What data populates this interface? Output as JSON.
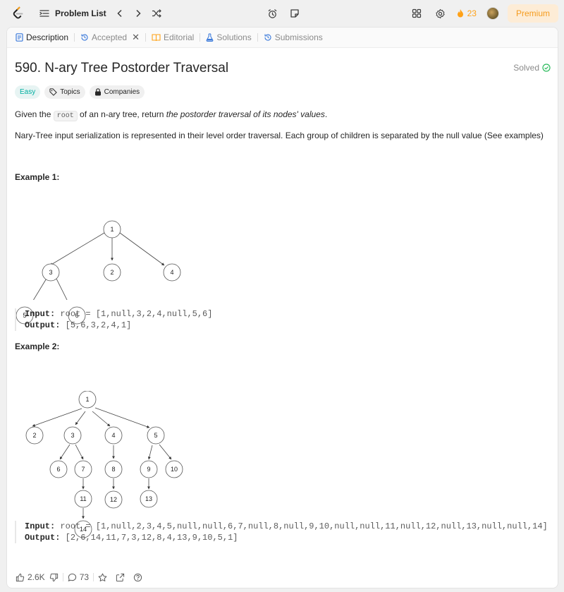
{
  "nav": {
    "problem_list": "Problem List",
    "streak": "23",
    "premium": "Premium",
    "colors": {
      "accent": "#ffa116",
      "easy": "#00afa1",
      "solved": "#2cbb5d"
    }
  },
  "tabs": [
    {
      "label": "Description",
      "icon": "description-icon"
    },
    {
      "label": "Accepted",
      "icon": "history-icon"
    },
    {
      "label": "Editorial",
      "icon": "book-icon"
    },
    {
      "label": "Solutions",
      "icon": "flask-icon"
    },
    {
      "label": "Submissions",
      "icon": "history-icon"
    }
  ],
  "problem": {
    "title": "590. N-ary Tree Postorder Traversal",
    "status": "Solved",
    "difficulty": "Easy",
    "topics": "Topics",
    "companies": "Companies",
    "desc_pre": "Given the ",
    "desc_code": "root",
    "desc_mid": " of an n-ary tree, return ",
    "desc_em": "the postorder traversal of its nodes' values",
    "desc_end": ".",
    "serialization": "Nary-Tree input serialization is represented in their level order traversal. Each group of children is separated by the null value (See examples)"
  },
  "examples": [
    {
      "title": "Example 1:",
      "input_label": "Input:",
      "input": "root = [1,null,3,2,4,null,5,6]",
      "output_label": "Output:",
      "output": "[5,6,3,2,4,1]"
    },
    {
      "title": "Example 2:",
      "input_label": "Input:",
      "input": "root = [1,null,2,3,4,5,null,null,6,7,null,8,null,9,10,null,null,11,null,12,null,13,null,null,14]",
      "output_label": "Output:",
      "output": "[2,6,14,11,7,3,12,8,4,13,9,10,5,1]"
    }
  ],
  "tree1": {
    "nodes": [
      "1",
      "3",
      "2",
      "4",
      "5",
      "6"
    ]
  },
  "tree2": {
    "nodes": [
      "1",
      "2",
      "3",
      "4",
      "5",
      "6",
      "7",
      "8",
      "9",
      "10",
      "11",
      "12",
      "13",
      "14"
    ]
  },
  "footer": {
    "likes": "2.6K",
    "comments": "73"
  }
}
